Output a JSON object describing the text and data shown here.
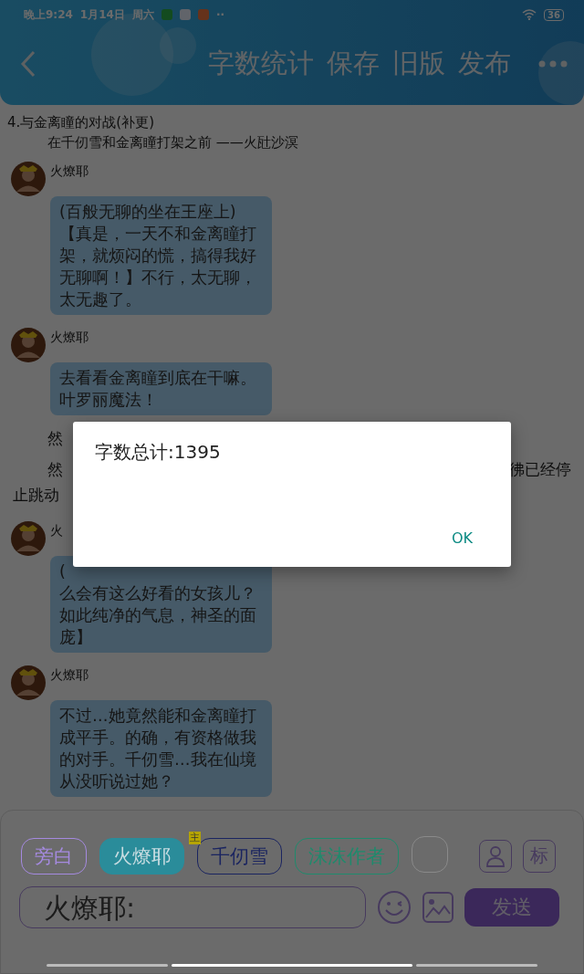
{
  "status_bar": {
    "time": "晚上9:24",
    "date": "1月14日",
    "weekday": "周六",
    "more": "··",
    "battery": "36"
  },
  "toolbar": {
    "actions": [
      "字数统计",
      "保存",
      "旧版",
      "发布"
    ]
  },
  "story": {
    "chapter": "4.与金离瞳的对战(补更)",
    "subtitle": "在千仞雪和金离瞳打架之前 ——火瓧沙溟",
    "items": [
      {
        "kind": "message",
        "sender": "火燎耶",
        "text": "(百般无聊的坐在王座上)【真是，一天不和金离瞳打架，就烦闷的慌，搞得我好无聊啊！】不行，太无聊，太无趣了。"
      },
      {
        "kind": "message",
        "sender": "火燎耶",
        "text": "去看看金离瞳到底在干嘛。叶罗丽魔法！"
      },
      {
        "kind": "narration",
        "text": "然"
      },
      {
        "kind": "narration",
        "text": "然",
        "tail": "彿已经停",
        "continuation": "止跳动"
      },
      {
        "kind": "message",
        "sender": "火",
        "text": "(",
        "rest": "么会有这么好看的女孩儿？如此纯净的气息，神圣的面庞】"
      },
      {
        "kind": "message",
        "sender": "火燎耶",
        "text": "不过…她竟然能和金离瞳打成平手。的确，有资格做我的对手。千仞雪…我在仙境从没听说过她？"
      }
    ]
  },
  "composer": {
    "roles": [
      {
        "label": "旁白",
        "selected": false,
        "color": "#a58ae0"
      },
      {
        "label": "火燎耶",
        "selected": true,
        "color": "#2a8c9a"
      },
      {
        "label": "千仞雪",
        "selected": false,
        "color": "#1a2460"
      },
      {
        "label": "沫沫作者",
        "selected": false,
        "color": "#1f8a6c"
      },
      {
        "selected": false,
        "color": "#8a8a8a"
      }
    ],
    "lead_badge": "主",
    "mark_button": "标",
    "placeholder": "火燎耶:",
    "send": "发送"
  },
  "dialog": {
    "message": "字数总计:1395",
    "ok": "OK"
  }
}
